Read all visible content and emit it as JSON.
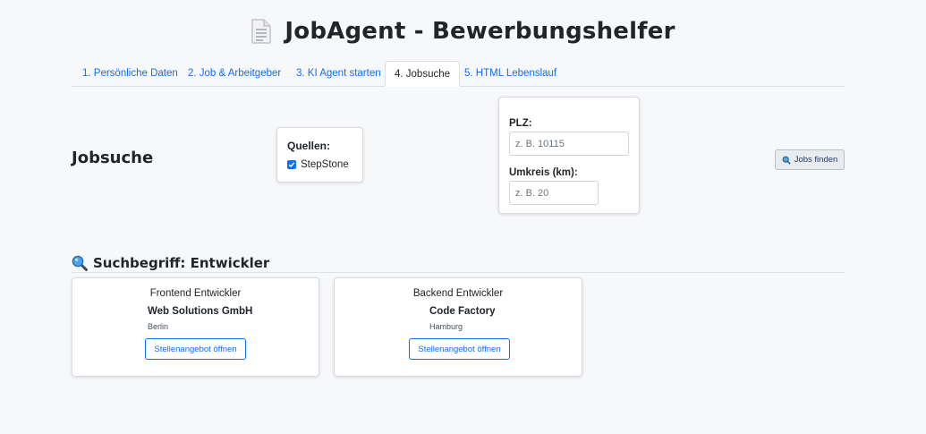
{
  "app": {
    "title": "JobAgent - Bewerbungshelfer"
  },
  "tabs": [
    {
      "label": "1. Persönliche Daten"
    },
    {
      "label": "2. Job & Arbeitgeber"
    },
    {
      "label": "3. KI Agent starten"
    },
    {
      "label": "4. Jobsuche"
    },
    {
      "label": "5. HTML Lebenslauf"
    }
  ],
  "jobsuche": {
    "title": "Jobsuche",
    "sources_label": "Quellen:",
    "source_stepstone": "StepStone",
    "plz_label": "PLZ:",
    "plz_placeholder": "z. B. 10115",
    "radius_label": "Umkreis (km):",
    "radius_placeholder": "z. B. 20",
    "find_button": "Jobs finden"
  },
  "results": {
    "heading": "Suchbegriff: Entwickler",
    "jobs": [
      {
        "title": "Frontend Entwickler",
        "company": "Web Solutions GmbH",
        "city": "Berlin",
        "button": "Stellenangebot öffnen"
      },
      {
        "title": "Backend Entwickler",
        "company": "Code Factory",
        "city": "Hamburg",
        "button": "Stellenangebot öffnen"
      }
    ]
  },
  "colors": {
    "accent": "#0d6efd",
    "background": "#f7f8fa"
  },
  "icons": {
    "title": "document-icon",
    "search": "magnifier-icon"
  }
}
